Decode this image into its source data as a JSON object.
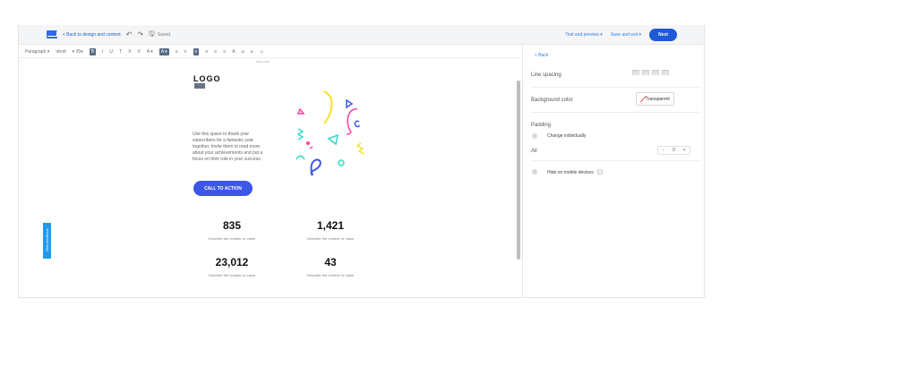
{
  "topbar": {
    "back_label": "< Back to design and content",
    "saved_label": "Saved",
    "test_preview": "Test and preview ▾",
    "save_exit": "Save and exit ▾",
    "next": "Next"
  },
  "toolbar": {
    "items": [
      "Paragraph ▾",
      "Verdi",
      "▾ 35▾",
      "B",
      "I",
      "U",
      "T",
      "X",
      "X",
      "A ▾",
      "A ▾",
      "≡",
      "≡",
      "≡",
      "≡",
      "≡",
      "≡",
      "A",
      "⌀",
      "⌀",
      "☺"
    ]
  },
  "canvas": {
    "view_online": "View online",
    "logo": "LOGO",
    "body_text": "Use this space to thank your subscribers for a fantastic year together. Invite them to read more about your achievements and put a focus on their role in your success.",
    "cta_label": "CALL TO ACTION",
    "stats": [
      {
        "value": "835",
        "desc": "Describe the number or value"
      },
      {
        "value": "1,421",
        "desc": "Describe the number or value"
      },
      {
        "value": "23,012",
        "desc": "Describe the number or value"
      },
      {
        "value": "43",
        "desc": "Describe the number or value"
      }
    ]
  },
  "panel": {
    "back_label": "< Back",
    "line_spacing": "Line spacing",
    "background_color": "Background color",
    "transparent_label": "Transparent",
    "padding": "Padding",
    "change_individually": "Change individually",
    "all_label": "All",
    "all_value": "0",
    "hide_mobile": "Hide on mobile devices"
  },
  "feedback": {
    "label": "Give feedback"
  }
}
